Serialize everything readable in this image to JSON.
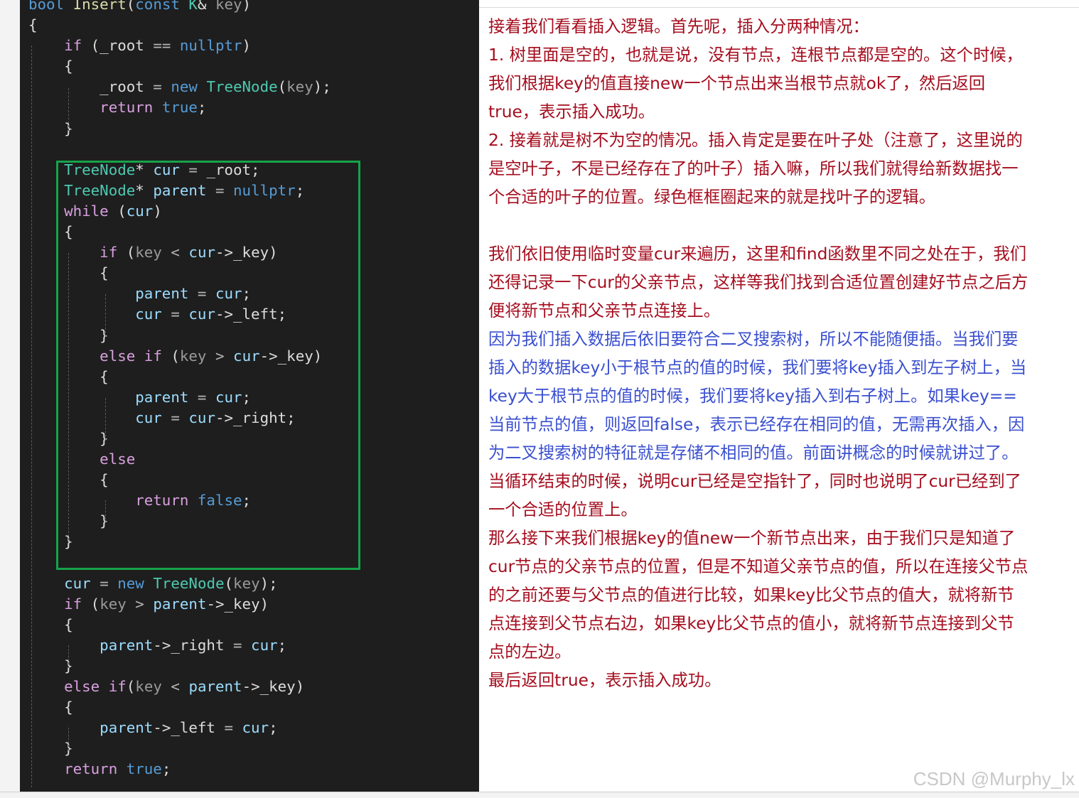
{
  "code": {
    "lines": [
      {
        "segs": [
          {
            "c": "kw",
            "t": "bool"
          },
          {
            "c": "",
            "t": " "
          },
          {
            "c": "fn",
            "t": "Insert"
          },
          {
            "c": "",
            "t": "("
          },
          {
            "c": "kw",
            "t": "const"
          },
          {
            "c": "",
            "t": " "
          },
          {
            "c": "ty",
            "t": "K"
          },
          {
            "c": "",
            "t": "& "
          },
          {
            "c": "pm",
            "t": "key"
          },
          {
            "c": "",
            "t": ")"
          }
        ]
      },
      {
        "segs": [
          {
            "c": "",
            "t": "{"
          }
        ]
      },
      {
        "segs": [
          {
            "c": "",
            "t": "    "
          },
          {
            "c": "kwc",
            "t": "if"
          },
          {
            "c": "",
            "t": " (_root "
          },
          {
            "c": "op",
            "t": "=="
          },
          {
            "c": "",
            "t": " "
          },
          {
            "c": "kw",
            "t": "nullptr"
          },
          {
            "c": "",
            "t": ")"
          }
        ]
      },
      {
        "segs": [
          {
            "c": "",
            "t": "    {"
          }
        ]
      },
      {
        "segs": [
          {
            "c": "",
            "t": "        _root "
          },
          {
            "c": "op",
            "t": "="
          },
          {
            "c": "",
            "t": " "
          },
          {
            "c": "kw",
            "t": "new"
          },
          {
            "c": "",
            "t": " "
          },
          {
            "c": "ty",
            "t": "TreeNode"
          },
          {
            "c": "",
            "t": "("
          },
          {
            "c": "pm",
            "t": "key"
          },
          {
            "c": "",
            "t": ");"
          }
        ]
      },
      {
        "segs": [
          {
            "c": "",
            "t": "        "
          },
          {
            "c": "kwc",
            "t": "return"
          },
          {
            "c": "",
            "t": " "
          },
          {
            "c": "kw",
            "t": "true"
          },
          {
            "c": "",
            "t": ";"
          }
        ]
      },
      {
        "segs": [
          {
            "c": "",
            "t": "    }"
          }
        ]
      },
      {
        "segs": [
          {
            "c": "",
            "t": ""
          }
        ]
      },
      {
        "segs": [
          {
            "c": "",
            "t": "    "
          },
          {
            "c": "ty",
            "t": "TreeNode"
          },
          {
            "c": "",
            "t": "* "
          },
          {
            "c": "vr",
            "t": "cur"
          },
          {
            "c": "",
            "t": " "
          },
          {
            "c": "op",
            "t": "="
          },
          {
            "c": "",
            "t": " _root;"
          }
        ]
      },
      {
        "segs": [
          {
            "c": "",
            "t": "    "
          },
          {
            "c": "ty",
            "t": "TreeNode"
          },
          {
            "c": "",
            "t": "* "
          },
          {
            "c": "vr",
            "t": "parent"
          },
          {
            "c": "",
            "t": " "
          },
          {
            "c": "op",
            "t": "="
          },
          {
            "c": "",
            "t": " "
          },
          {
            "c": "kw",
            "t": "nullptr"
          },
          {
            "c": "",
            "t": ";"
          }
        ]
      },
      {
        "segs": [
          {
            "c": "",
            "t": "    "
          },
          {
            "c": "kwc",
            "t": "while"
          },
          {
            "c": "",
            "t": " ("
          },
          {
            "c": "vr",
            "t": "cur"
          },
          {
            "c": "",
            "t": ")"
          }
        ]
      },
      {
        "segs": [
          {
            "c": "",
            "t": "    {"
          }
        ]
      },
      {
        "segs": [
          {
            "c": "",
            "t": "        "
          },
          {
            "c": "kwc",
            "t": "if"
          },
          {
            "c": "",
            "t": " ("
          },
          {
            "c": "pm",
            "t": "key"
          },
          {
            "c": "",
            "t": " "
          },
          {
            "c": "op",
            "t": "<"
          },
          {
            "c": "",
            "t": " "
          },
          {
            "c": "vr",
            "t": "cur"
          },
          {
            "c": "",
            "t": "->_key)"
          }
        ]
      },
      {
        "segs": [
          {
            "c": "",
            "t": "        {"
          }
        ]
      },
      {
        "segs": [
          {
            "c": "",
            "t": "            "
          },
          {
            "c": "vr",
            "t": "parent"
          },
          {
            "c": "",
            "t": " "
          },
          {
            "c": "op",
            "t": "="
          },
          {
            "c": "",
            "t": " "
          },
          {
            "c": "vr",
            "t": "cur"
          },
          {
            "c": "",
            "t": ";"
          }
        ]
      },
      {
        "segs": [
          {
            "c": "",
            "t": "            "
          },
          {
            "c": "vr",
            "t": "cur"
          },
          {
            "c": "",
            "t": " "
          },
          {
            "c": "op",
            "t": "="
          },
          {
            "c": "",
            "t": " "
          },
          {
            "c": "vr",
            "t": "cur"
          },
          {
            "c": "",
            "t": "->_left;"
          }
        ]
      },
      {
        "segs": [
          {
            "c": "",
            "t": "        }"
          }
        ]
      },
      {
        "segs": [
          {
            "c": "",
            "t": "        "
          },
          {
            "c": "kwc",
            "t": "else"
          },
          {
            "c": "",
            "t": " "
          },
          {
            "c": "kwc",
            "t": "if"
          },
          {
            "c": "",
            "t": " ("
          },
          {
            "c": "pm",
            "t": "key"
          },
          {
            "c": "",
            "t": " "
          },
          {
            "c": "op",
            "t": ">"
          },
          {
            "c": "",
            "t": " "
          },
          {
            "c": "vr",
            "t": "cur"
          },
          {
            "c": "",
            "t": "->_key)"
          }
        ]
      },
      {
        "segs": [
          {
            "c": "",
            "t": "        {"
          }
        ]
      },
      {
        "segs": [
          {
            "c": "",
            "t": "            "
          },
          {
            "c": "vr",
            "t": "parent"
          },
          {
            "c": "",
            "t": " "
          },
          {
            "c": "op",
            "t": "="
          },
          {
            "c": "",
            "t": " "
          },
          {
            "c": "vr",
            "t": "cur"
          },
          {
            "c": "",
            "t": ";"
          }
        ]
      },
      {
        "segs": [
          {
            "c": "",
            "t": "            "
          },
          {
            "c": "vr",
            "t": "cur"
          },
          {
            "c": "",
            "t": " "
          },
          {
            "c": "op",
            "t": "="
          },
          {
            "c": "",
            "t": " "
          },
          {
            "c": "vr",
            "t": "cur"
          },
          {
            "c": "",
            "t": "->_right;"
          }
        ]
      },
      {
        "segs": [
          {
            "c": "",
            "t": "        }"
          }
        ]
      },
      {
        "segs": [
          {
            "c": "",
            "t": "        "
          },
          {
            "c": "kwc",
            "t": "else"
          }
        ]
      },
      {
        "segs": [
          {
            "c": "",
            "t": "        {"
          }
        ]
      },
      {
        "segs": [
          {
            "c": "",
            "t": "            "
          },
          {
            "c": "kwc",
            "t": "return"
          },
          {
            "c": "",
            "t": " "
          },
          {
            "c": "kw",
            "t": "false"
          },
          {
            "c": "",
            "t": ";"
          }
        ]
      },
      {
        "segs": [
          {
            "c": "",
            "t": "        }"
          }
        ]
      },
      {
        "segs": [
          {
            "c": "",
            "t": "    }"
          }
        ]
      },
      {
        "segs": [
          {
            "c": "",
            "t": ""
          }
        ]
      },
      {
        "segs": [
          {
            "c": "",
            "t": "    "
          },
          {
            "c": "vr",
            "t": "cur"
          },
          {
            "c": "",
            "t": " "
          },
          {
            "c": "op",
            "t": "="
          },
          {
            "c": "",
            "t": " "
          },
          {
            "c": "kw",
            "t": "new"
          },
          {
            "c": "",
            "t": " "
          },
          {
            "c": "ty",
            "t": "TreeNode"
          },
          {
            "c": "",
            "t": "("
          },
          {
            "c": "pm",
            "t": "key"
          },
          {
            "c": "",
            "t": ");"
          }
        ]
      },
      {
        "segs": [
          {
            "c": "",
            "t": "    "
          },
          {
            "c": "kwc",
            "t": "if"
          },
          {
            "c": "",
            "t": " ("
          },
          {
            "c": "pm",
            "t": "key"
          },
          {
            "c": "",
            "t": " "
          },
          {
            "c": "op",
            "t": ">"
          },
          {
            "c": "",
            "t": " "
          },
          {
            "c": "vr",
            "t": "parent"
          },
          {
            "c": "",
            "t": "->_key)"
          }
        ]
      },
      {
        "segs": [
          {
            "c": "",
            "t": "    {"
          }
        ]
      },
      {
        "segs": [
          {
            "c": "",
            "t": "        "
          },
          {
            "c": "vr",
            "t": "parent"
          },
          {
            "c": "",
            "t": "->_right "
          },
          {
            "c": "op",
            "t": "="
          },
          {
            "c": "",
            "t": " "
          },
          {
            "c": "vr",
            "t": "cur"
          },
          {
            "c": "",
            "t": ";"
          }
        ]
      },
      {
        "segs": [
          {
            "c": "",
            "t": "    }"
          }
        ]
      },
      {
        "segs": [
          {
            "c": "",
            "t": "    "
          },
          {
            "c": "kwc",
            "t": "else"
          },
          {
            "c": "",
            "t": " "
          },
          {
            "c": "kwc",
            "t": "if"
          },
          {
            "c": "",
            "t": "("
          },
          {
            "c": "pm",
            "t": "key"
          },
          {
            "c": "",
            "t": " "
          },
          {
            "c": "op",
            "t": "<"
          },
          {
            "c": "",
            "t": " "
          },
          {
            "c": "vr",
            "t": "parent"
          },
          {
            "c": "",
            "t": "->_key)"
          }
        ]
      },
      {
        "segs": [
          {
            "c": "",
            "t": "    {"
          }
        ]
      },
      {
        "segs": [
          {
            "c": "",
            "t": "        "
          },
          {
            "c": "vr",
            "t": "parent"
          },
          {
            "c": "",
            "t": "->_left "
          },
          {
            "c": "op",
            "t": "="
          },
          {
            "c": "",
            "t": " "
          },
          {
            "c": "vr",
            "t": "cur"
          },
          {
            "c": "",
            "t": ";"
          }
        ]
      },
      {
        "segs": [
          {
            "c": "",
            "t": "    }"
          }
        ]
      },
      {
        "segs": [
          {
            "c": "",
            "t": "    "
          },
          {
            "c": "kwc",
            "t": "return"
          },
          {
            "c": "",
            "t": " "
          },
          {
            "c": "kw",
            "t": "true"
          },
          {
            "c": "",
            "t": ";"
          }
        ]
      }
    ]
  },
  "colors": {
    "code_bg": "#1e1e1e",
    "highlight_box": "#16a34a",
    "text_red": "#a50d1e",
    "text_blue": "#3a4fcf"
  },
  "explanation": {
    "p1": "接着我们看看插入逻辑。首先呢，插入分两种情况：",
    "p2": "1. 树里面是空的，也就是说，没有节点，连根节点都是空的。这个时候，我们根据key的值直接new一个节点出来当根节点就ok了，然后返回true，表示插入成功。",
    "p3": "2. 接着就是树不为空的情况。插入肯定是要在叶子处（注意了，这里说的是空叶子，不是已经存在了的叶子）插入嘛，所以我们就得给新数据找一个合适的叶子的位置。绿色框框圈起来的就是找叶子的逻辑。",
    "p4": "我们依旧使用临时变量cur来遍历，这里和find函数里不同之处在于，我们还得记录一下cur的父亲节点，这样等我们找到合适位置创建好节点之后方便将新节点和父亲节点连接上。",
    "p5": "因为我们插入数据后依旧要符合二叉搜索树，所以不能随便插。当我们要插入的数据key小于根节点的值的时候，我们要将key插入到左子树上，当key大于根节点的值的时候，我们要将key插入到右子树上。如果key==当前节点的值，则返回false，表示已经存在相同的值，无需再次插入，因为二叉搜索树的特征就是存储不相同的值。前面讲概念的时候就讲过了。",
    "p6": "当循环结束的时候，说明cur已经是空指针了，同时也说明了cur已经到了一个合适的位置上。",
    "p7": "那么接下来我们根据key的值new一个新节点出来，由于我们只是知道了cur节点的父亲节点的位置，但是不知道父亲节点的值，所以在连接父节点的之前还要与父节点的值进行比较，如果key比父节点的值大，就将新节点连接到父节点右边，如果key比父节点的值小，就将新节点连接到父节点的左边。",
    "p8": "最后返回true，表示插入成功。"
  },
  "watermark": "CSDN @Murphy_lx"
}
